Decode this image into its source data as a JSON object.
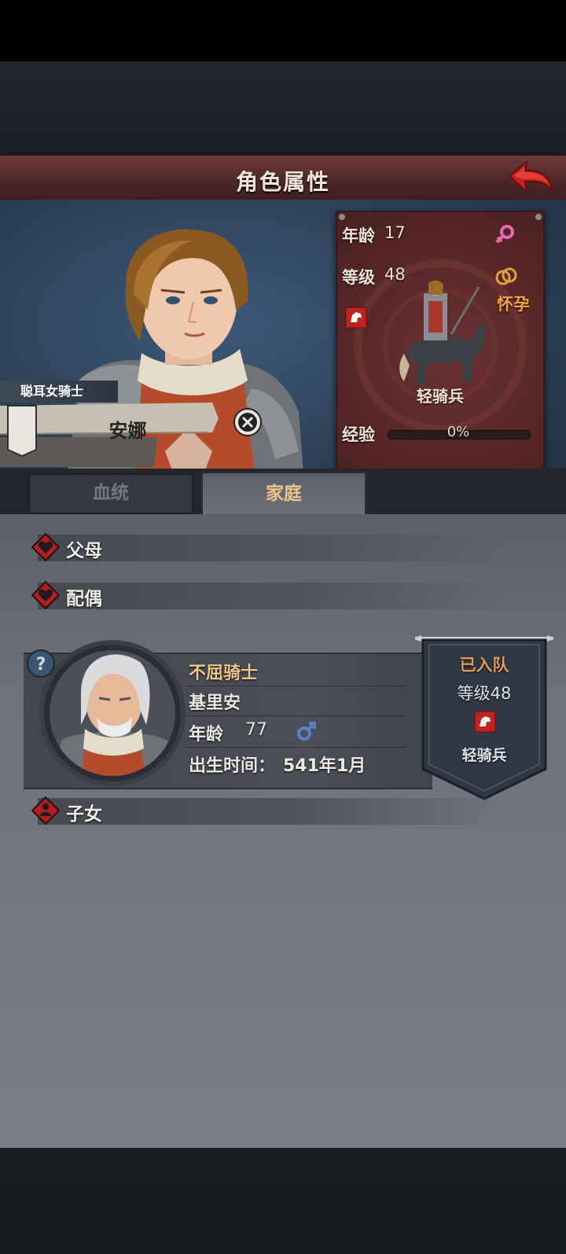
{
  "header": {
    "title": "角色属性"
  },
  "hero": {
    "title": "聪耳女骑士",
    "name": "安娜",
    "age_label": "年龄",
    "age": "17",
    "level_label": "等级",
    "level": "48",
    "status": "怀孕",
    "unit_type": "轻骑兵",
    "exp_label": "经验",
    "exp_value": "0%",
    "exp_fraction": 0
  },
  "tabs": [
    {
      "label": "血统",
      "active": false
    },
    {
      "label": "家庭",
      "active": true
    }
  ],
  "family": {
    "parents_label": "父母",
    "spouse_label": "配偶",
    "children_label": "子女",
    "spouse": {
      "title": "不屈骑士",
      "name": "基里安",
      "age_label": "年龄",
      "age": "77",
      "birth_label": "出生时间：",
      "birth": "541年1月",
      "status": "已入队",
      "level_label": "等级",
      "level": "48",
      "unit_type": "轻骑兵"
    }
  },
  "colors": {
    "accent_gold": "#f1c58a",
    "status_orange": "#e69b57",
    "female_pink": "#e36bb5",
    "male_blue": "#5a7fc4",
    "header_red": "#5a2a2b"
  },
  "icons": {
    "back": "back-arrow-icon",
    "female": "female-icon",
    "male": "male-icon",
    "ring": "ring-icon",
    "horse_badge": "horse-badge-icon",
    "close": "close-icon",
    "heart": "heart-icon",
    "child": "child-icon",
    "help": "question-icon"
  }
}
